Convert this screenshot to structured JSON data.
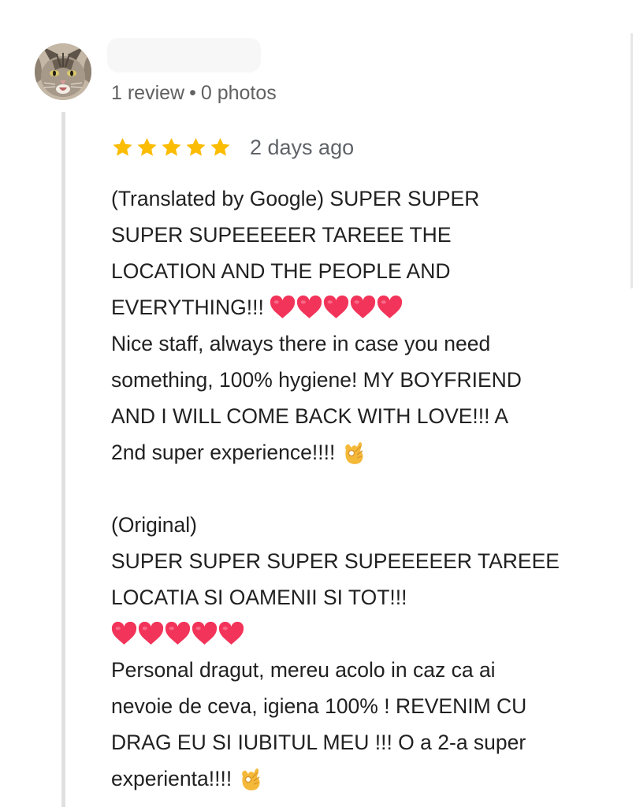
{
  "reviewer": {
    "avatar_icon": "cat-photo-avatar",
    "stats": {
      "reviews": "1 review",
      "separator": "•",
      "photos": "0 photos"
    }
  },
  "review": {
    "rating": 5,
    "rating_max": 5,
    "star_color": "#FBBC04",
    "date": "2 days ago",
    "translated_lines": [
      "(Translated by Google) SUPER SUPER",
      "SUPER SUPEEEEER TAREEE THE",
      "LOCATION AND THE PEOPLE AND",
      "EVERYTHING!!!",
      "Nice staff, always there in case you need",
      "something, 100% hygiene! MY BOYFRIEND",
      "AND I WILL COME BACK WITH LOVE!!! A",
      "2nd super experience!!!!"
    ],
    "original_lines": [
      "(Original)",
      "SUPER SUPER SUPER SUPEEEEER TAREEE",
      "LOCATIA SI OAMENII SI TOT!!!",
      "",
      "Personal dragut, mereu acolo in caz ca ai",
      "nevoie de ceva, igiena 100% ! REVENIM CU",
      "DRAG EU SI IUBITUL MEU !!! O a 2-a super",
      "experienta!!!!"
    ],
    "emoji": {
      "heart": "red-heart-icon",
      "heart_color": "#F2345A",
      "ok_hand": "ok-hand-icon"
    }
  }
}
